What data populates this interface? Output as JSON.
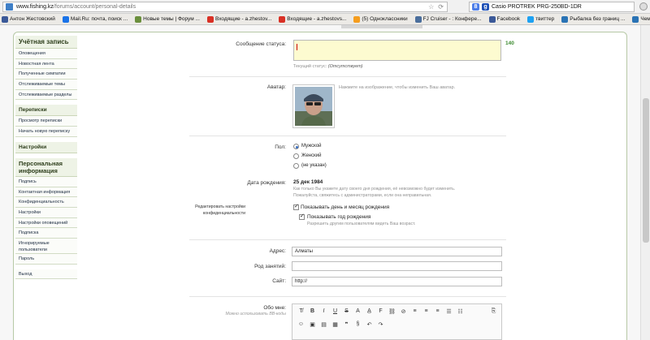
{
  "browser": {
    "url_host": "www.fishing.kz",
    "url_path": "/forums/account/personal-details",
    "search_text": "Casio PROTREK PRG-250BD-1DR",
    "bookmarks": [
      {
        "label": "Антон Жестовский",
        "color": "#3b5998"
      },
      {
        "label": "Mail.Ru: почта, поиск ...",
        "color": "#1a73e8"
      },
      {
        "label": "Новые темы | Форум ...",
        "color": "#6a8f3c"
      },
      {
        "label": "Входящие - a.zhestov...",
        "color": "#d93025"
      },
      {
        "label": "Входящие - a.zhestovs...",
        "color": "#d93025"
      },
      {
        "label": "(5) Одноклассники",
        "color": "#f59d1e"
      },
      {
        "label": "FJ Cruiser - : Конфере...",
        "color": "#4a6e9c"
      },
      {
        "label": "Facebook",
        "color": "#3b5998"
      },
      {
        "label": "твиттер",
        "color": "#1da1f2"
      },
      {
        "label": "Рыбалка без границ ...",
        "color": "#2a73b5"
      },
      {
        "label": "Чемпионат Казахстан...",
        "color": "#2a73b5"
      }
    ]
  },
  "sidebar": {
    "account_title": "Учётная запись",
    "account_items": [
      "Оповещения",
      "Новостная лента",
      "Полученные симпатии",
      "Отслеживаемые темы",
      "Отслеживаемые разделы"
    ],
    "conversations_title": "Переписки",
    "conversations_items": [
      "Просмотр переписки",
      "Начать новую переписку"
    ],
    "settings_title": "Настройки",
    "personal_title": "Персональная информация",
    "personal_items": [
      "Подпись",
      "Контактная информация",
      "Конфиденциальность",
      "Настройки",
      "Настройки оповещений",
      "Подписка",
      "Игнорируемые пользователи",
      "Пароль"
    ],
    "logout": "Выход"
  },
  "form": {
    "status_label": "Сообщение статуса:",
    "status_counter": "140",
    "current_status_label": "Текущий статус:",
    "current_status_value": "(Отсутствует)",
    "avatar_label": "Аватар:",
    "avatar_hint": "Нажмите на изображение, чтобы изменить Ваш аватар.",
    "gender_label": "Пол:",
    "gender_options": [
      "Мужской",
      "Женский",
      "(не указан)"
    ],
    "gender_selected": 0,
    "birthday_label": "Дата рождения:",
    "birthday_value": "25 дек 1984",
    "birthday_hint_1": "Как только Вы укажете дату своего дня рождения, её невозможно будет изменить.",
    "birthday_hint_2": "Пожалуйста, свяжитесь с администраторами, если она неправильная.",
    "privacy_label_1": "Редактировать настройки",
    "privacy_label_2": "конфиденциальности",
    "show_day_month": "Показывать день и месяц рождения",
    "show_year": "Показывать год рождения",
    "show_year_hint": "Разрешить другим пользователям видеть Ваш возраст.",
    "address_label": "Адрес:",
    "address_value": "Алматы",
    "occupation_label": "Род занятий:",
    "occupation_value": "",
    "site_label": "Сайт:",
    "site_value": "http://",
    "about_label": "Обо мне:",
    "about_hint": "Можно использовать BB-коды"
  }
}
